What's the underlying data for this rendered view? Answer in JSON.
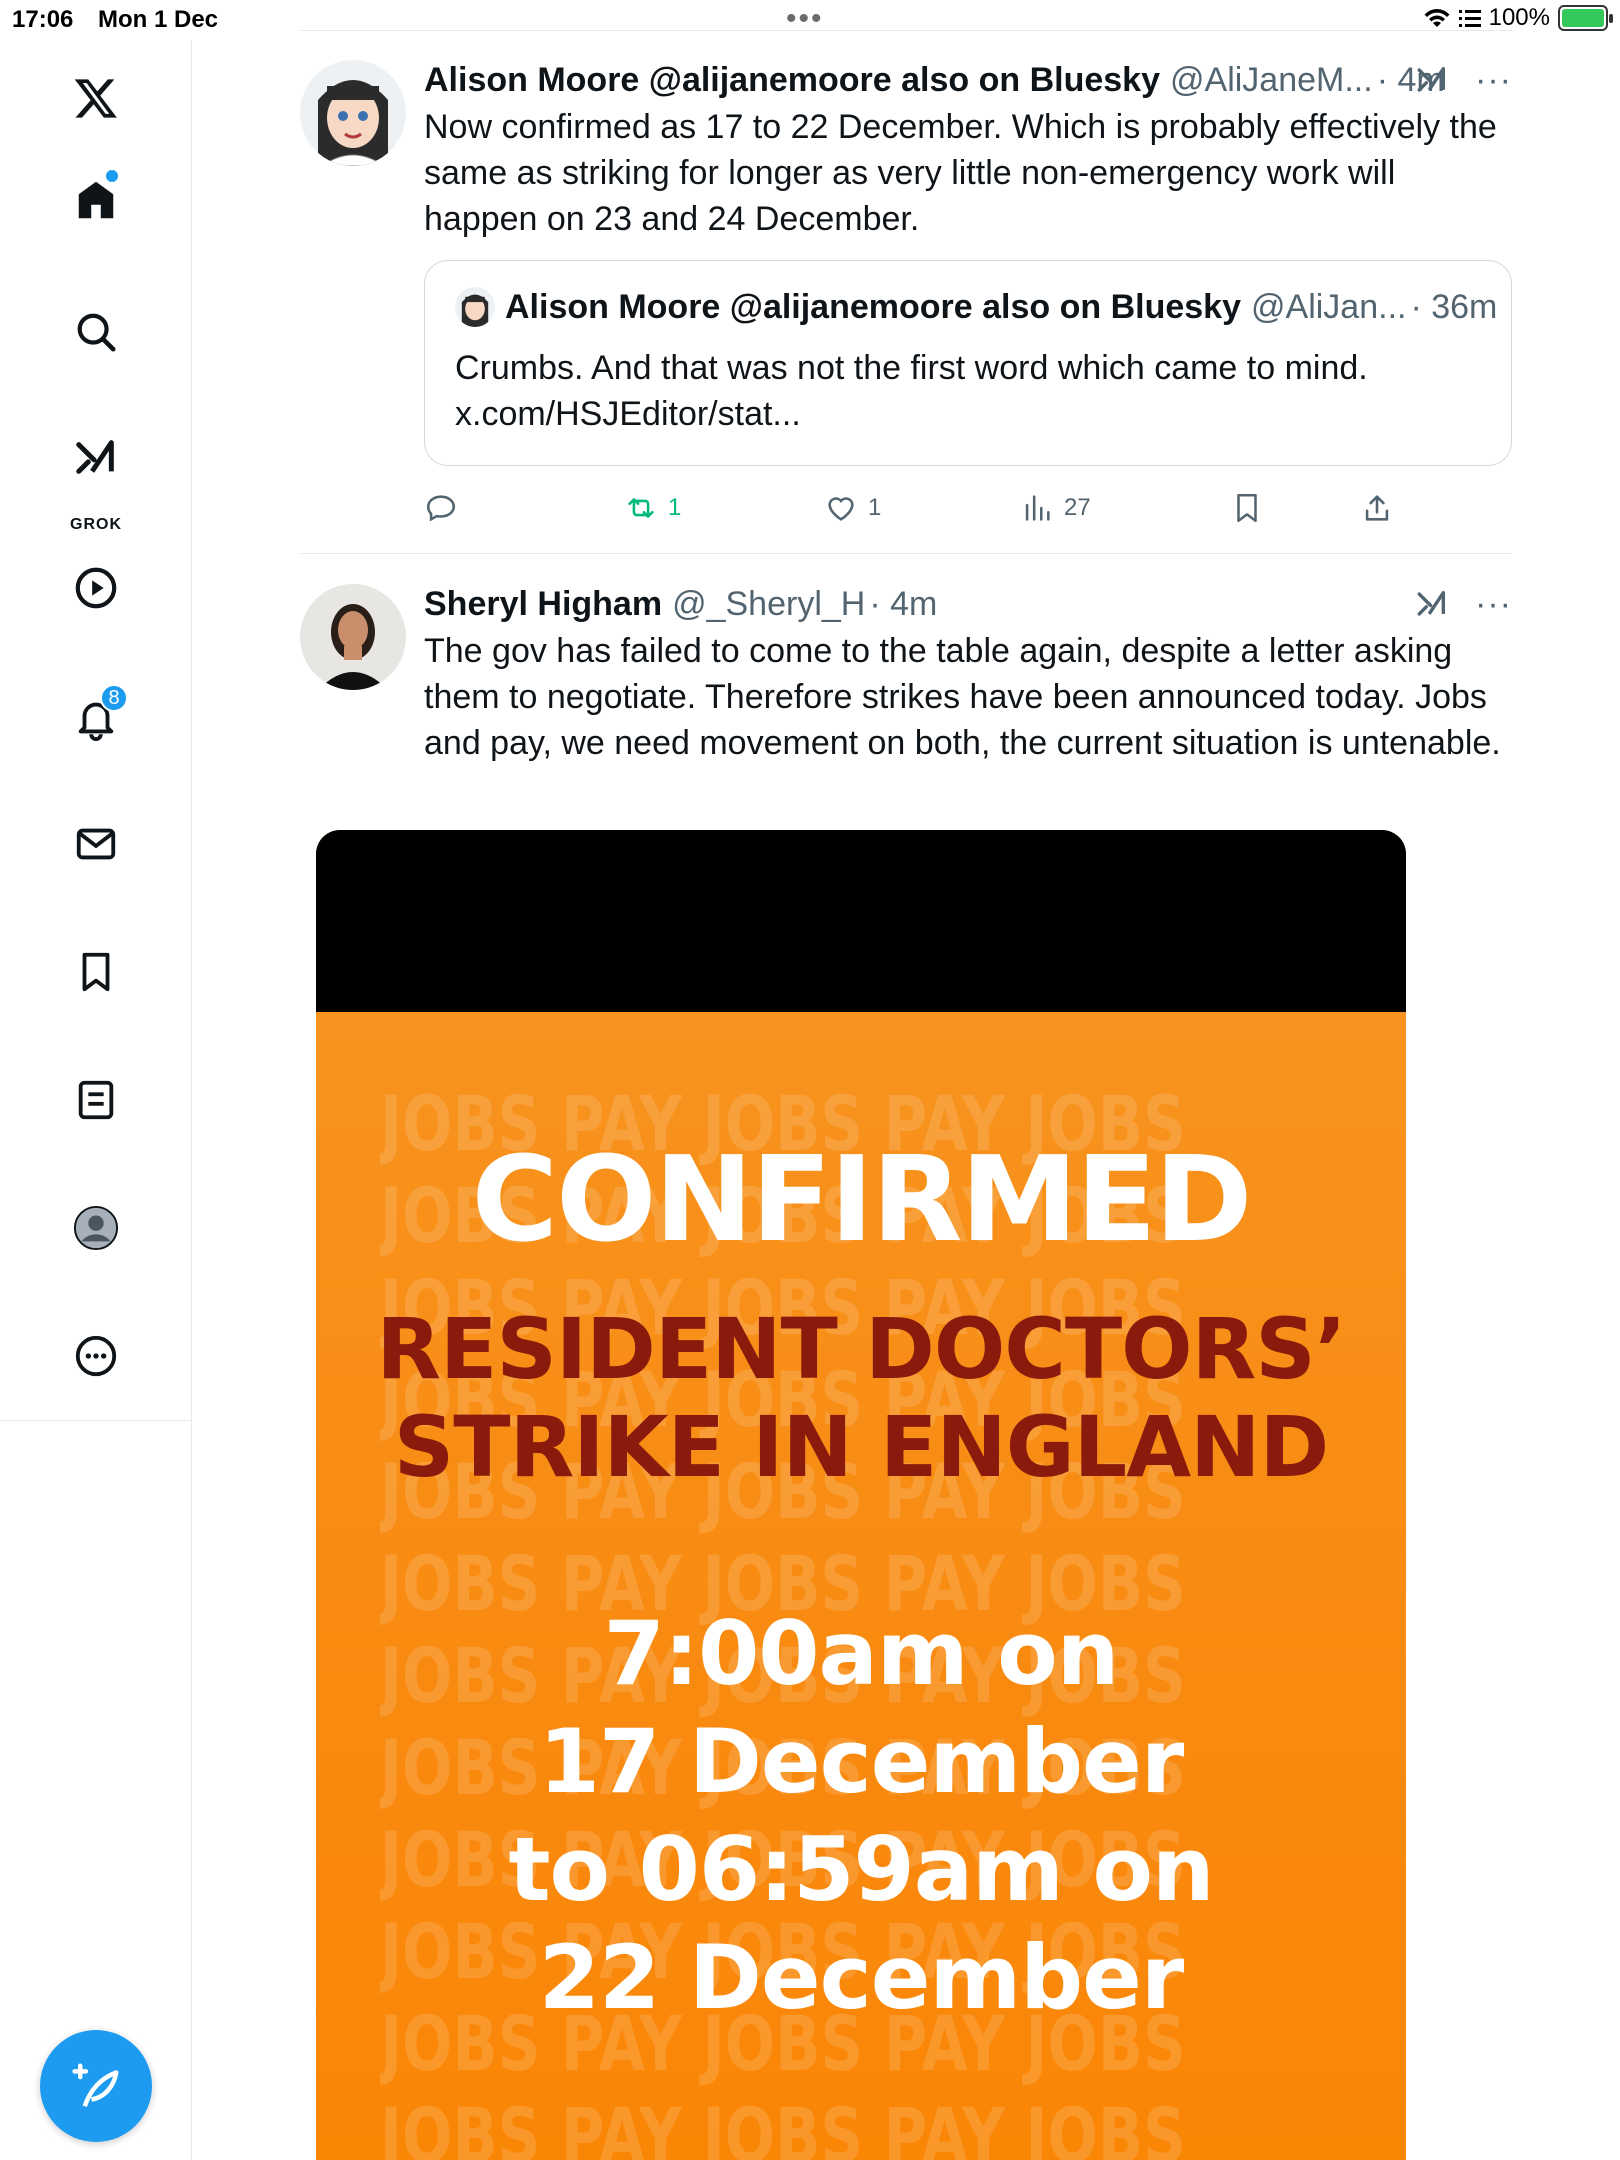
{
  "status_bar": {
    "time": "17:06",
    "date": "Mon 1 Dec",
    "multitask": "•••",
    "battery_percent": "100%",
    "battery_color": "#34c759"
  },
  "sidebar": {
    "items": [
      {
        "name": "x-logo-icon"
      },
      {
        "name": "home-icon",
        "has_dot": true
      },
      {
        "name": "search-icon"
      },
      {
        "name": "grok-icon",
        "label": "GROK"
      },
      {
        "name": "video-icon"
      },
      {
        "name": "notifications-icon",
        "badge": "8"
      },
      {
        "name": "messages-icon"
      },
      {
        "name": "bookmarks-icon"
      },
      {
        "name": "lists-icon"
      },
      {
        "name": "profile-icon"
      },
      {
        "name": "more-icon"
      }
    ],
    "compose_icon": "compose-icon",
    "accent": "#1d9bf0"
  },
  "tweets": [
    {
      "name": "Alison Moore @alijanemoore also on Bluesky",
      "handle": "@AliJaneM...",
      "time": "· 4m",
      "text": "Now confirmed as 17 to 22 December. Which is probably effectively the same as striking for longer as very little non-emergency work will happen on 23 and 24 December.",
      "quote": {
        "name": "Alison Moore @alijanemoore also on Bluesky",
        "handle": "@AliJan...",
        "time": "· 36m",
        "text": "Crumbs. And that was not the first word which came to mind.",
        "link": "x.com/HSJEditor/stat..."
      },
      "actions": {
        "replies": "",
        "retweets": "1",
        "likes": "1",
        "views": "27"
      }
    },
    {
      "name": "Sheryl Higham",
      "handle": "@_Sheryl_H",
      "time": "· 4m",
      "text": "The gov has failed to come to the table again, despite a letter asking them to negotiate. Therefore strikes have been announced today. Jobs and pay, we need movement on both, the current situation is untenable.",
      "media": {
        "headline": "CONFIRMED",
        "subhead_1": "RESIDENT DOCTORS’",
        "subhead_2": "STRIKE IN ENGLAND",
        "line_1": "7:00am on",
        "line_2": "17 December",
        "line_3": "to 06:59am on",
        "line_4": "22 December",
        "bg_words": [
          "JOBS PAY JOBS PAY JOBS",
          "JOBS PAY JOBS PAY JOBS",
          "JOBS PAY JOBS PAY JOBS",
          "JOBS PAY JOBS PAY JOBS",
          "JOBS PAY JOBS PAY JOBS",
          "JOBS PAY JOBS PAY JOBS",
          "JOBS PAY JOBS PAY JOBS",
          "JOBS PAY JOBS PAY JOBS",
          "JOBS PAY JOBS PAY JOBS",
          "JOBS PAY JOBS PAY JOBS",
          "JOBS PAY JOBS PAY JOBS",
          "JOBS PAY JOBS PAY JOBS"
        ],
        "colors": {
          "orange": "#f98b0e",
          "dark_red": "#8a1a0c"
        }
      }
    }
  ]
}
